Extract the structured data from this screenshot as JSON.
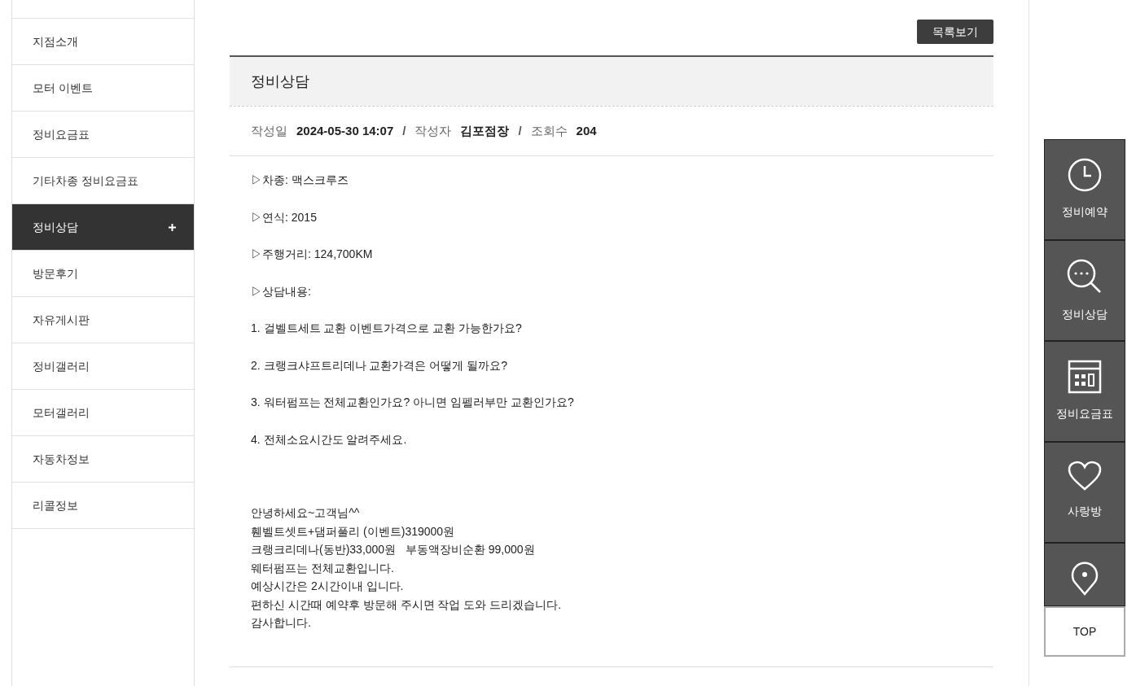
{
  "sidebar": {
    "items": [
      {
        "label": "지점소개",
        "selected": false
      },
      {
        "label": "모터 이벤트",
        "selected": false
      },
      {
        "label": "정비요금표",
        "selected": false
      },
      {
        "label": "기타차종 정비요금표",
        "selected": false
      },
      {
        "label": "정비상담",
        "selected": true
      },
      {
        "label": "방문후기",
        "selected": false
      },
      {
        "label": "자유게시판",
        "selected": false
      },
      {
        "label": "정비갤러리",
        "selected": false
      },
      {
        "label": "모터갤러리",
        "selected": false
      },
      {
        "label": "자동차정보",
        "selected": false
      },
      {
        "label": "리콜정보",
        "selected": false
      }
    ]
  },
  "list_button": "목록보기",
  "post": {
    "title": "정비상담",
    "meta": [
      {
        "label": "작성일",
        "value": "2024-05-30 14:07"
      },
      {
        "label": "작성자",
        "value": "김포점장"
      },
      {
        "label": "조회수",
        "value": "204"
      }
    ],
    "separator": "/",
    "body": [
      {
        "kind": "spaced",
        "lines": [
          "▷차종: 맥스크루즈",
          "▷연식: 2015",
          "▷주행거리: 124,700KM",
          "▷상담내용:",
          "1. 걸벨트세트 교환 이벤트가격으로 교환 가능한가요?",
          "2. 크랭크샤프트리데나 교환가격은 어떻게 될까요?",
          "3. 워터펌프는 전체교환인가요? 아니면 임펠러부만 교환인가요?",
          "4. 전체소요시간도 알려주세요."
        ]
      },
      {
        "kind": "compact",
        "lines": [
          "안녕하세요~고객님^^",
          "휀벨트셋트+댐퍼풀리 (이벤트)319000원",
          "크랭크리데나(동반)33,000원   부동액장비순환 99,000원",
          "웨터펌프는 전체교환입니다.",
          "예상시간은 2시간이내 입니다.",
          "편하신 시간때 예약후 방문해 주시면 작업 도와 드리겠습니다.",
          "감사합니다."
        ]
      }
    ]
  },
  "quick_menu": {
    "items": [
      {
        "kind": "clock",
        "label": "정비예약"
      },
      {
        "kind": "search",
        "label": "정비상담"
      },
      {
        "kind": "table",
        "label": "정비요금표"
      },
      {
        "kind": "heart",
        "label": "사랑방"
      },
      {
        "kind": "pin"
      }
    ],
    "top_button": "TOP"
  }
}
